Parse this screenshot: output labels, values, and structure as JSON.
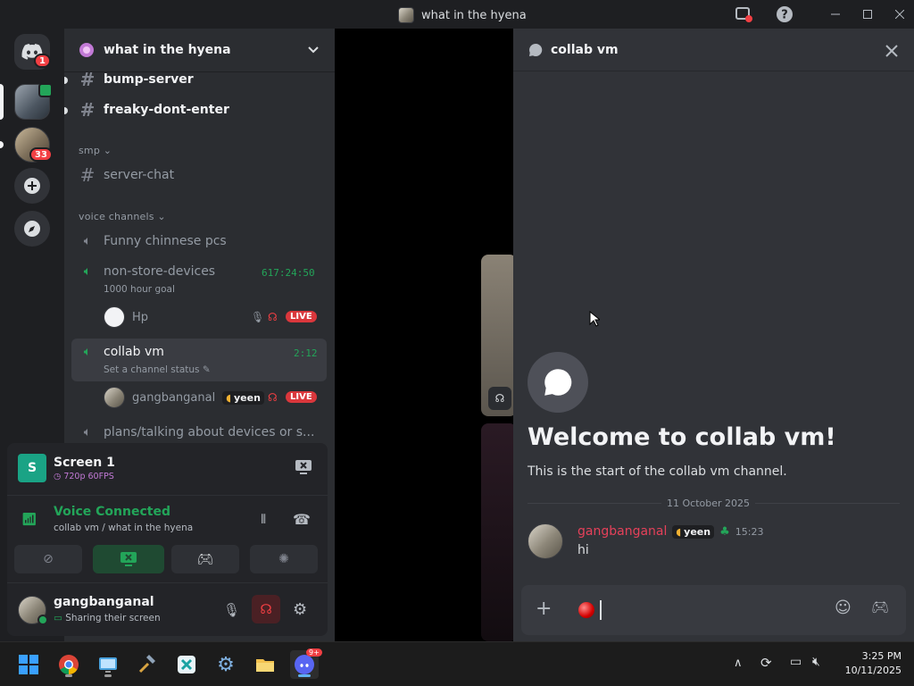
{
  "window": {
    "title": "what in the hyena"
  },
  "rail": {
    "home_badge": "1",
    "server2_badge": "33"
  },
  "sidebar": {
    "server_name": "what in the hyena",
    "channels_top": [
      {
        "name": "bump-server"
      },
      {
        "name": "freaky-dont-enter"
      }
    ],
    "category_smp": "smp",
    "channel_smp": "server-chat",
    "category_voice": "voice channels",
    "voice_1": "Funny chinnese pcs",
    "voice_2": {
      "name": "non-store-devices",
      "timer": "617:24:50",
      "status": "1000 hour goal",
      "user": "Hp",
      "live": "LIVE"
    },
    "voice_3": {
      "name": "collab vm",
      "timer": "2:12",
      "status": "Set a channel status",
      "user": "gangbanganal",
      "tag": "yeen",
      "live": "LIVE"
    },
    "voice_4": "plans/talking about devices or s..."
  },
  "stream": {
    "title": "Screen 1",
    "quality": "720p 60FPS",
    "icon_letter": "S"
  },
  "voice": {
    "status": "Voice Connected",
    "location": "collab vm / what in the hyena"
  },
  "user": {
    "name": "gangbanganal",
    "status": "Sharing their screen"
  },
  "chat": {
    "channel": "collab vm",
    "welcome_title": "Welcome to collab vm!",
    "welcome_sub": "This is the start of the collab vm channel.",
    "date": "11 October 2025",
    "message": {
      "author": "gangbanganal",
      "tag": "yeen",
      "time": "15:23",
      "text": "hi"
    }
  },
  "taskbar": {
    "time": "3:25 PM",
    "date": "10/11/2025",
    "discord_badge": "9+"
  },
  "colors": {
    "accent": "#5865f2",
    "online": "#23a559",
    "live": "#da373c",
    "author": "#e5415a"
  }
}
